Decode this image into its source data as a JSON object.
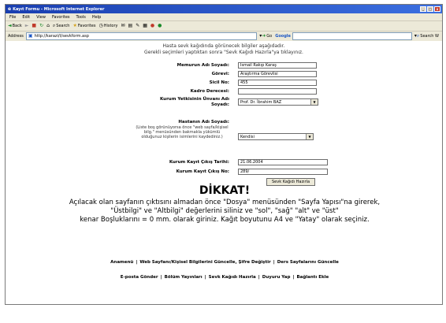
{
  "window": {
    "title": "Kayıt Formu - Microsoft Internet Explorer"
  },
  "menu": [
    "File",
    "Edit",
    "View",
    "Favorites",
    "Tools",
    "Help"
  ],
  "toolbar": {
    "back": "Back",
    "search": "Search",
    "favorites": "Favorites",
    "history": "History"
  },
  "address": {
    "label": "Address",
    "url": "http://karazi/t/sevkform.asp",
    "go": "Go",
    "google": "Google",
    "search_web": "Search W"
  },
  "intro": {
    "line1": "Hasta sevk kağıdında görünecek bilgiler aşağıdadır.",
    "line2": "Gerekli seçimleri yaptıktan sonra \"Sevk Kağıdı Hazırla\"ya tıklayınız."
  },
  "form": {
    "memur_label": "Memurun Adı Soyadı:",
    "memur_value": "İsmail Rakıp Karaş",
    "gorev_label": "Görevi:",
    "gorev_value": "Araştırma Görevlisi",
    "sicil_label": "Sicil No:",
    "sicil_value": "455",
    "kadro_label": "Kadro Derecesi:",
    "kadro_value": "",
    "yetkili_label1": "Kurum Yetkisinin Ünvanı Adı",
    "yetkili_label2": "Soyadı:",
    "yetkili_value": "Prof. Dr. İbrahim BAZ",
    "hasta_label": "Hastanın Adı Soyadı:",
    "hasta_hint": "(Liste boş görünüyorsa önce \"web sayfa/kişisel bilg.\" menüsünden bakmakla yükümlü olduğunuz kişilerin isimlerini kaydediniz.)",
    "hasta_value": "Kendisi",
    "tarih_label": "Kurum Kayıt Çıkış Tarihi:",
    "tarih_value": "21.06.2004",
    "cikis_no_label": "Kurum Kayıt Çıkış No:",
    "cikis_no_value": "289/",
    "submit": "Sevk Kağıdı Hazırla"
  },
  "warning": {
    "title": "DİKKAT!",
    "line1": "Açılacak olan sayfanın çıktısını almadan önce \"Dosya\" menüsünden \"Sayfa Yapısı\"na girerek,",
    "line2": "\"Üstbilgi\" ve \"Altbilgi\" değerlerini siliniz ve \"sol\", \"sağ\" \"alt\" ve \"üst\"",
    "line3": "kenar Boşluklarını = 0 mm. olarak giriniz. Kağıt boyutunu A4 ve \"Yatay\" olarak seçiniz."
  },
  "links_row1": [
    "Anamenü",
    "Web Sayfanı/Kişisel Bilgilerini Güncelle, Şifre Değiştir",
    "Ders Sayfalarını Güncelle"
  ],
  "links_row2": [
    "E-posta Gönder",
    "Bölüm Yayınları",
    "Sevk Kağıdı Hazırla",
    "Duyuru Yap",
    "Bağlantı Ekle"
  ]
}
